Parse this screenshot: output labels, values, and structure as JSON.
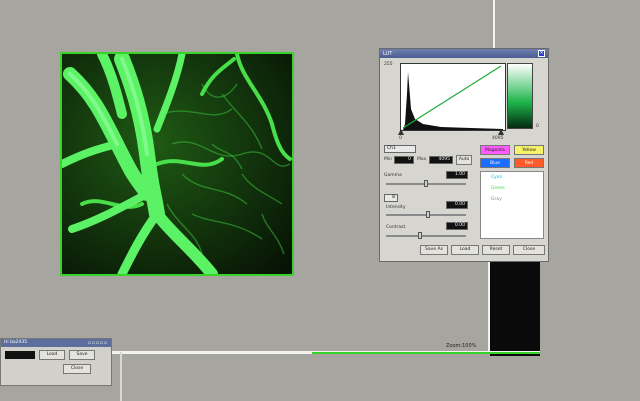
{
  "lut_dialog": {
    "title": "LUT",
    "hist_min": "0",
    "hist_max": "4095",
    "scale_top": "255",
    "scale_bottom": "0",
    "channel_select": "Ch1",
    "min_label": "Min",
    "min_value": "0",
    "max_label": "Max",
    "max_value": "4095",
    "auto_label": "Auto",
    "gamma_label": "Gamma",
    "gamma_value": "1.00",
    "intensity_select": "8",
    "intensity_label": "Intensity",
    "intensity_value": "0.00",
    "contrast_label": "Contrast",
    "contrast_value": "0.00",
    "color_buttons": [
      "Magenta",
      "Yellow",
      "Blue",
      "Red"
    ],
    "color_list": [
      "Cyan",
      "Green",
      "Gray"
    ],
    "bottom_buttons": [
      "Save As",
      "Load",
      "Reset",
      "Close"
    ]
  },
  "mini_window": {
    "title": "Hi ba2435",
    "buttons_row1": [
      "Load",
      "Save"
    ],
    "buttons_row2": [
      "Close"
    ]
  },
  "status_bar": {
    "zoom": "Zoom:100%"
  },
  "colors": {
    "desktop": "#a7a59f",
    "green_accent": "#39d22a",
    "vessel_green": "#4ee85a"
  }
}
